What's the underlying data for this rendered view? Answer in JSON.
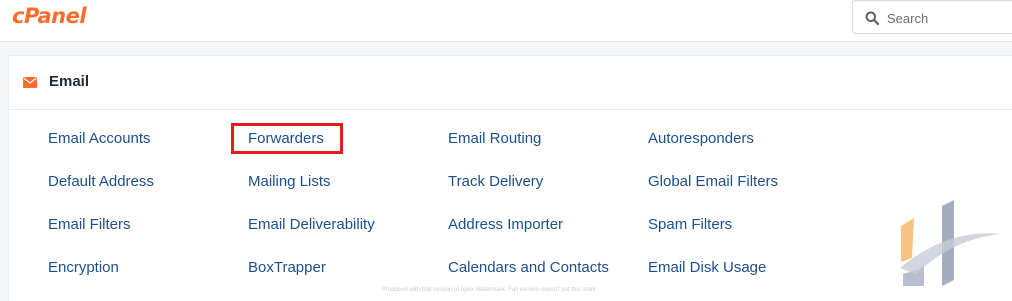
{
  "header": {
    "logo_text": "cPanel",
    "search_placeholder": "Search"
  },
  "section": {
    "icon": "envelope-icon",
    "title": "Email"
  },
  "items": [
    {
      "label": "Email Accounts"
    },
    {
      "label": "Forwarders",
      "highlighted": true
    },
    {
      "label": "Email Routing"
    },
    {
      "label": "Autoresponders"
    },
    {
      "label": "Default Address"
    },
    {
      "label": "Mailing Lists"
    },
    {
      "label": "Track Delivery"
    },
    {
      "label": "Global Email Filters"
    },
    {
      "label": "Email Filters"
    },
    {
      "label": "Email Deliverability"
    },
    {
      "label": "Address Importer"
    },
    {
      "label": "Spam Filters"
    },
    {
      "label": "Encryption"
    },
    {
      "label": "BoxTrapper"
    },
    {
      "label": "Calendars and Contacts"
    },
    {
      "label": "Email Disk Usage"
    }
  ],
  "footer_note": "Produced with trial version of Apex Watermark. Full version doesn't put this mark.",
  "colors": {
    "brand": "#ff6c2c",
    "link": "#1d4f8c",
    "highlight_border": "#e21b1b"
  }
}
